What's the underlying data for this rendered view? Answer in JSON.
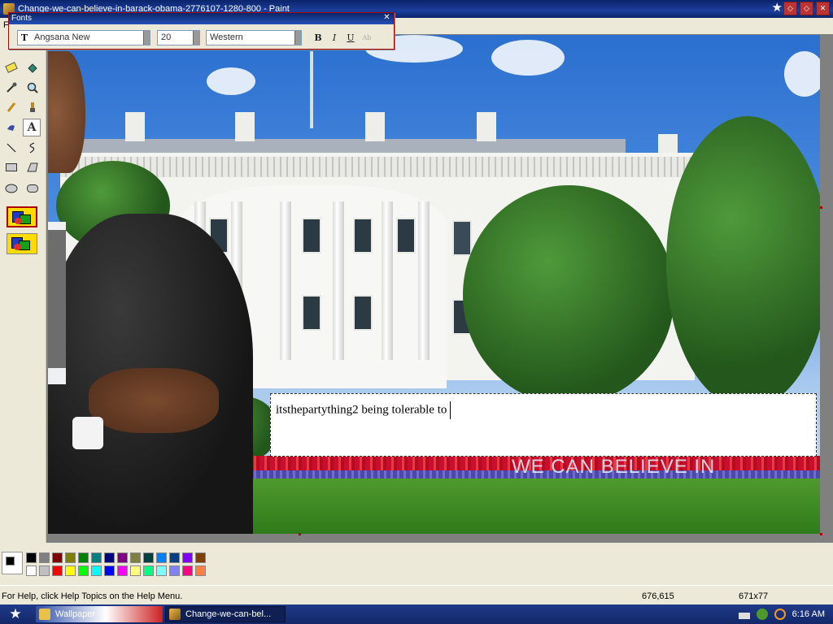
{
  "window": {
    "title": "Change-we-can-believe-in-barack-obama-2776107-1280-800 - Paint",
    "controls": [
      "minimize",
      "maximize",
      "close"
    ],
    "menu_hint": "F"
  },
  "fonts_toolbar": {
    "title": "Fonts",
    "font_name": "Angsana New",
    "font_size": "20",
    "script": "Western",
    "bold": "B",
    "italic": "I",
    "underline": "U",
    "vertical": "Ab"
  },
  "canvas": {
    "slogan": "WE CAN BELIEVE IN",
    "text_box_content": "itsthepartything2 being tolerable to"
  },
  "palette": {
    "foreground": "#000000",
    "background": "#ffffff",
    "top_row": [
      "#000000",
      "#808080",
      "#800000",
      "#808000",
      "#008000",
      "#008080",
      "#000080",
      "#800080",
      "#808040",
      "#004040",
      "#0080ff",
      "#004080",
      "#8000ff",
      "#804000"
    ],
    "bottom_row": [
      "#ffffff",
      "#c0c0c0",
      "#ff0000",
      "#ffff00",
      "#00ff00",
      "#00ffff",
      "#0000ff",
      "#ff00ff",
      "#ffff80",
      "#00ff80",
      "#80ffff",
      "#8080ff",
      "#ff0080",
      "#ff8040"
    ]
  },
  "status": {
    "help": "For Help, click Help Topics on the Help Menu.",
    "coords": "676,615",
    "size": "671x77"
  },
  "taskbar": {
    "wallpaper_item": "Wallpaper",
    "active_item": "Change-we-can-bel...",
    "clock": "6:16 AM"
  }
}
